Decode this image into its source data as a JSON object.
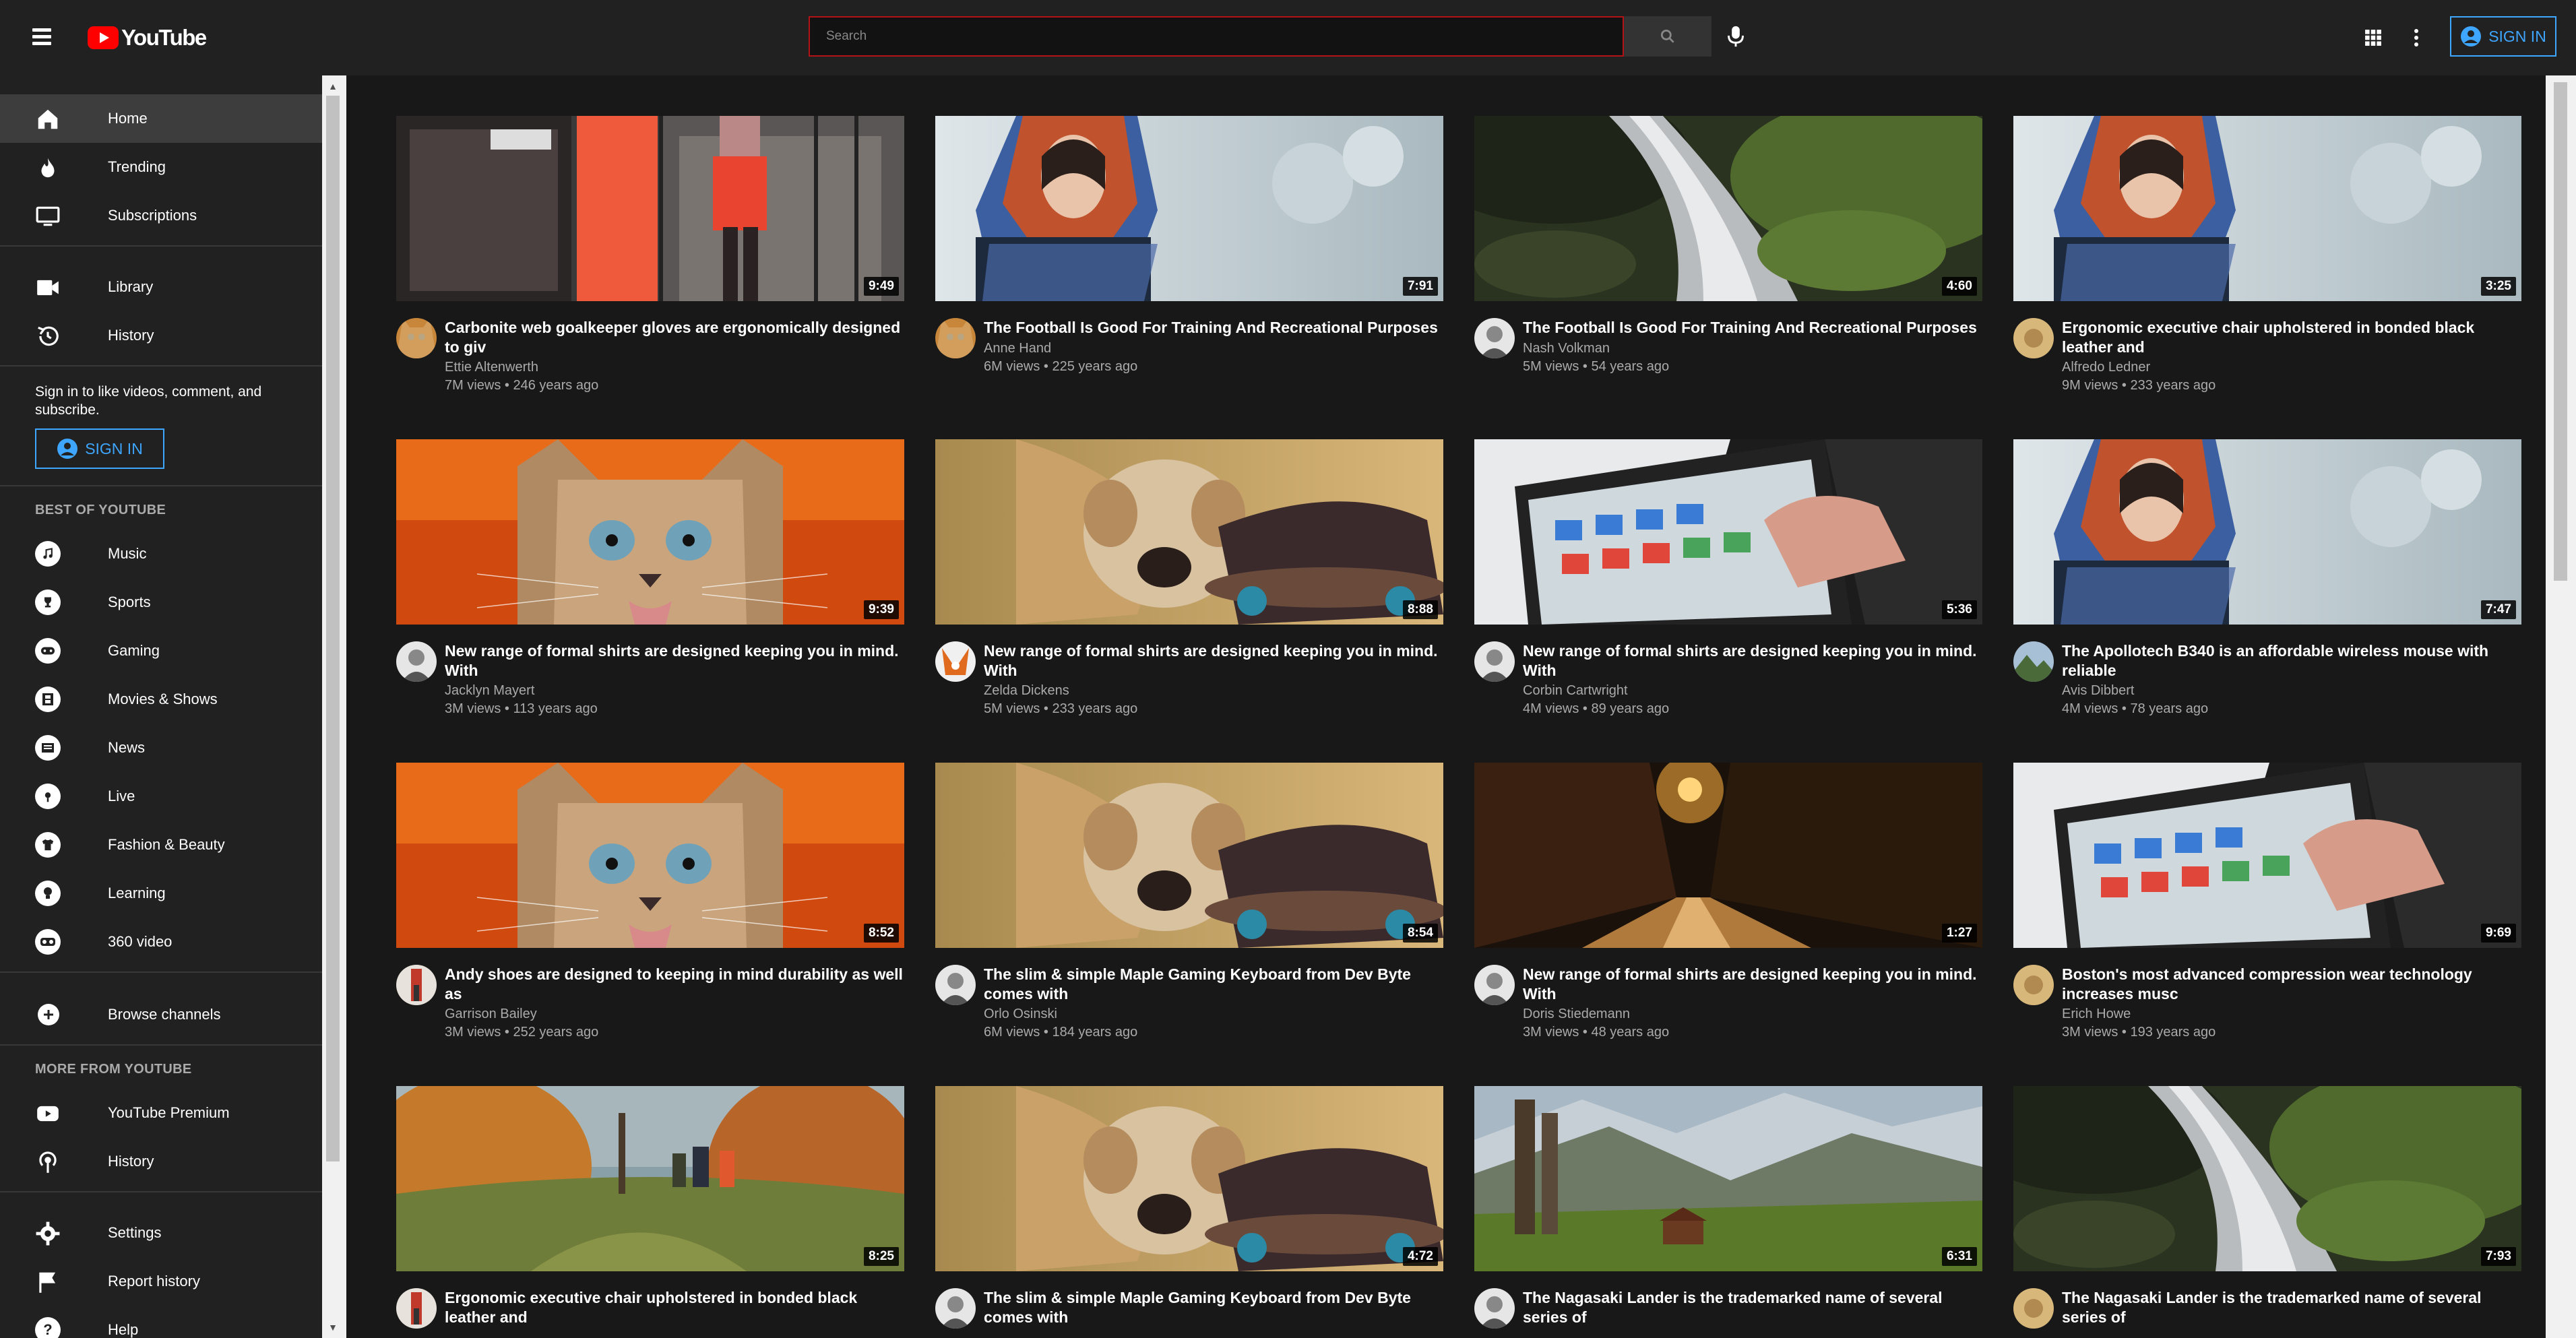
{
  "header": {
    "logo_text": "YouTube",
    "search_placeholder": "Search",
    "signin_label": "SIGN IN"
  },
  "sidebar": {
    "main_items": [
      {
        "label": "Home",
        "icon": "home-icon",
        "active": true
      },
      {
        "label": "Trending",
        "icon": "flame-icon"
      },
      {
        "label": "Subscriptions",
        "icon": "subscriptions-icon"
      }
    ],
    "library_items": [
      {
        "label": "Library",
        "icon": "library-icon"
      },
      {
        "label": "History",
        "icon": "history-icon"
      }
    ],
    "signin_prompt": "Sign in to like videos, comment, and subscribe.",
    "signin_label": "SIGN IN",
    "best_heading": "BEST OF YOUTUBE",
    "best_items": [
      {
        "label": "Music",
        "icon": "music-icon"
      },
      {
        "label": "Sports",
        "icon": "trophy-icon"
      },
      {
        "label": "Gaming",
        "icon": "gamepad-icon"
      },
      {
        "label": "Movies & Shows",
        "icon": "film-icon"
      },
      {
        "label": "News",
        "icon": "news-icon"
      },
      {
        "label": "Live",
        "icon": "live-icon"
      },
      {
        "label": "Fashion & Beauty",
        "icon": "tshirt-icon"
      },
      {
        "label": "Learning",
        "icon": "lightbulb-icon"
      },
      {
        "label": "360 video",
        "icon": "vr-icon"
      }
    ],
    "browse_label": "Browse channels",
    "more_heading": "MORE FROM YOUTUBE",
    "more_items": [
      {
        "label": "YouTube Premium",
        "icon": "youtube-premium-icon"
      },
      {
        "label": "History",
        "icon": "live-history-icon"
      }
    ],
    "footer_items": [
      {
        "label": "Settings",
        "icon": "gear-icon"
      },
      {
        "label": "Report history",
        "icon": "flag-icon"
      },
      {
        "label": "Help",
        "icon": "help-icon"
      }
    ]
  },
  "videos": [
    {
      "title": "Carbonite web goalkeeper gloves are ergonomically designed to giv",
      "channel": "Ettie Altenwerth",
      "meta": "7M views • 246 years ago",
      "duration": "9:49",
      "thumb": "city-woman"
    },
    {
      "title": "The Football Is Good For Training And Recreational Purposes",
      "channel": "Anne Hand",
      "meta": "6M views • 225 years ago",
      "duration": "7:91",
      "thumb": "scarf-woman"
    },
    {
      "title": "The Football Is Good For Training And Recreational Purposes",
      "channel": "Nash Volkman",
      "meta": "5M views • 54 years ago",
      "duration": "4:60",
      "thumb": "stream"
    },
    {
      "title": "Ergonomic executive chair upholstered in bonded black leather and",
      "channel": "Alfredo Ledner",
      "meta": "9M views • 233 years ago",
      "duration": "3:25",
      "thumb": "scarf-woman"
    },
    {
      "title": "New range of formal shirts are designed keeping you in mind. With",
      "channel": "Jacklyn Mayert",
      "meta": "3M views • 113 years ago",
      "duration": "9:39",
      "thumb": "cat"
    },
    {
      "title": "New range of formal shirts are designed keeping you in mind. With",
      "channel": "Zelda Dickens",
      "meta": "5M views • 233 years ago",
      "duration": "8:88",
      "thumb": "puppy"
    },
    {
      "title": "New range of formal shirts are designed keeping you in mind. With",
      "channel": "Corbin Cartwright",
      "meta": "4M views • 89 years ago",
      "duration": "5:36",
      "thumb": "tablet"
    },
    {
      "title": "The Apollotech B340 is an affordable wireless mouse with reliable",
      "channel": "Avis Dibbert",
      "meta": "4M views • 78 years ago",
      "duration": "7:47",
      "thumb": "scarf-woman"
    },
    {
      "title": "Andy shoes are designed to keeping in mind durability as well as",
      "channel": "Garrison Bailey",
      "meta": "3M views • 252 years ago",
      "duration": "8:52",
      "thumb": "cat"
    },
    {
      "title": "The slim & simple Maple Gaming Keyboard from Dev Byte comes with",
      "channel": "Orlo Osinski",
      "meta": "6M views • 184 years ago",
      "duration": "8:54",
      "thumb": "puppy"
    },
    {
      "title": "New range of formal shirts are designed keeping you in mind. With",
      "channel": "Doris Stiedemann",
      "meta": "3M views • 48 years ago",
      "duration": "1:27",
      "thumb": "night-road"
    },
    {
      "title": "Boston's most advanced compression wear technology increases musc",
      "channel": "Erich Howe",
      "meta": "3M views • 193 years ago",
      "duration": "9:69",
      "thumb": "tablet"
    },
    {
      "title": "Ergonomic executive chair upholstered in bonded black leather and",
      "channel": "",
      "meta": "",
      "duration": "8:25",
      "thumb": "hikers"
    },
    {
      "title": "The slim & simple Maple Gaming Keyboard from Dev Byte comes with",
      "channel": "",
      "meta": "",
      "duration": "4:72",
      "thumb": "puppy"
    },
    {
      "title": "The Nagasaki Lander is the trademarked name of several series of",
      "channel": "",
      "meta": "",
      "duration": "6:31",
      "thumb": "mountains"
    },
    {
      "title": "The Nagasaki Lander is the trademarked name of several series of",
      "channel": "",
      "meta": "",
      "duration": "7:93",
      "thumb": "stream"
    }
  ],
  "avatars": [
    "cat-avatar",
    "cat-avatar",
    "bw-avatar",
    "gold-avatar",
    "bw-avatar",
    "fox-avatar",
    "bw-avatar",
    "mountain-avatar",
    "red-avatar",
    "bw-avatar",
    "bw-avatar",
    "gold-avatar",
    "red-avatar",
    "bw-avatar",
    "bw-avatar",
    "gold-avatar"
  ]
}
